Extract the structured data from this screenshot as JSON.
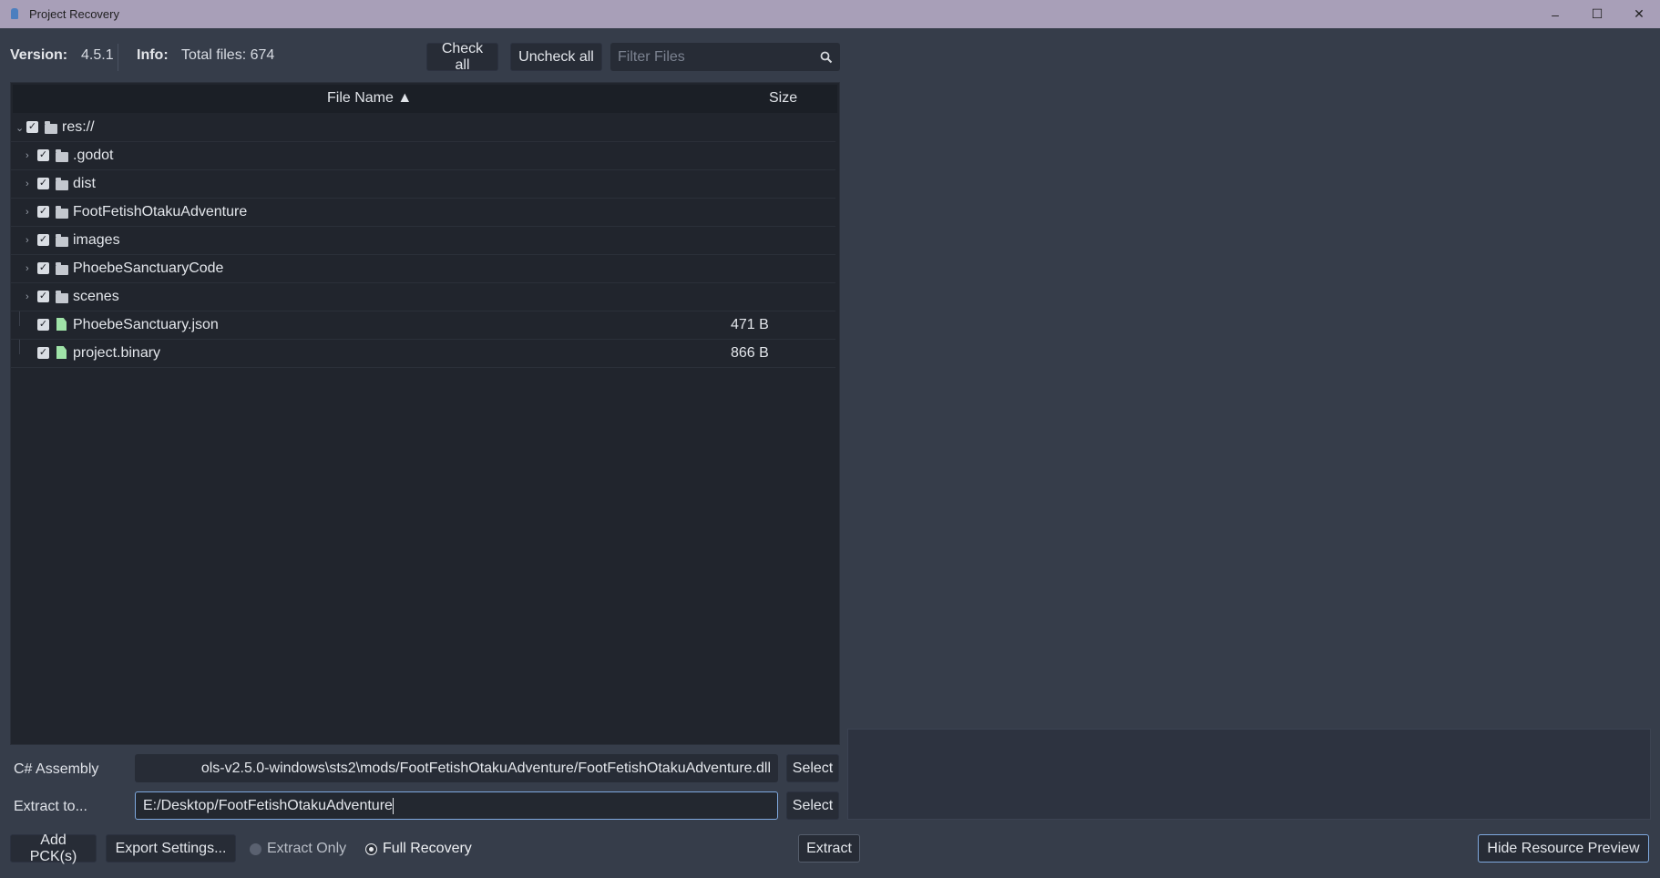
{
  "window": {
    "title": "Project Recovery",
    "controls": {
      "minimize": "–",
      "maximize": "☐",
      "close": "✕"
    }
  },
  "toolbar": {
    "version_label": "Version:",
    "version_value": "4.5.1",
    "info_label": "Info:",
    "info_value": "Total files: 674",
    "check_all": "Check all",
    "uncheck_all": "Uncheck all",
    "filter_placeholder": "Filter Files",
    "search_icon": "search-icon"
  },
  "tree": {
    "columns": {
      "name": "File Name ▲",
      "size": "Size"
    },
    "rows": [
      {
        "label": "res://",
        "type": "folder",
        "size": "",
        "checked": true,
        "expanded": true
      },
      {
        "label": ".godot",
        "type": "folder",
        "size": "",
        "checked": true,
        "expanded": false
      },
      {
        "label": "dist",
        "type": "folder",
        "size": "",
        "checked": true,
        "expanded": false
      },
      {
        "label": "FootFetishOtakuAdventure",
        "type": "folder",
        "size": "",
        "checked": true,
        "expanded": false
      },
      {
        "label": "images",
        "type": "folder",
        "size": "",
        "checked": true,
        "expanded": false
      },
      {
        "label": "PhoebeSanctuaryCode",
        "type": "folder",
        "size": "",
        "checked": true,
        "expanded": false
      },
      {
        "label": "scenes",
        "type": "folder",
        "size": "",
        "checked": true,
        "expanded": false
      },
      {
        "label": "PhoebeSanctuary.json",
        "type": "file",
        "size": "471 B",
        "checked": true
      },
      {
        "label": "project.binary",
        "type": "file",
        "size": "866 B",
        "checked": true
      }
    ]
  },
  "form": {
    "assembly_label": "C# Assembly",
    "assembly_value": "ols-v2.5.0-windows\\sts2\\mods/FootFetishOtakuAdventure/FootFetishOtakuAdventure.dll",
    "assembly_select": "Select",
    "extract_label": "Extract to...",
    "extract_value": "E:/Desktop/FootFetishOtakuAdventure",
    "extract_select": "Select"
  },
  "bottom": {
    "add_pck": "Add PCK(s)",
    "export_settings": "Export Settings...",
    "mode_extract_only": "Extract Only",
    "mode_full_recovery": "Full Recovery",
    "selected_mode": "Full Recovery",
    "extract": "Extract",
    "hide_preview": "Hide Resource Preview"
  }
}
